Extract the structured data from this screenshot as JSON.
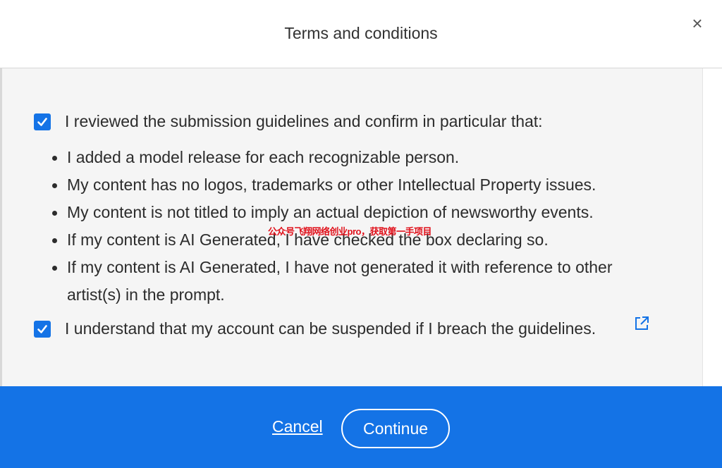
{
  "dialog": {
    "title": "Terms and conditions",
    "close_label": "×"
  },
  "terms": {
    "guidelines_checkbox": {
      "checked": true,
      "label": "I reviewed the submission guidelines and confirm in particular that:"
    },
    "bullets": [
      "I added a model release for each recognizable person.",
      "My content has no logos, trademarks or other Intellectual Property issues.",
      "My content is not titled to imply an actual depiction of newsworthy events.",
      "If my content is AI Generated, I have checked the box declaring so.",
      "If my content is AI Generated, I have not generated it with reference to other artist(s) in the prompt."
    ],
    "suspension_checkbox": {
      "checked": true,
      "label": "I understand that my account can be suspended if I breach the guidelines."
    },
    "external_link_icon": "external-link-icon"
  },
  "watermark": "公众号飞翔网络创业pro，获取第一手项目",
  "footer": {
    "cancel_label": "Cancel",
    "continue_label": "Continue"
  },
  "colors": {
    "accent": "#1473e6",
    "watermark": "#e0101a"
  }
}
